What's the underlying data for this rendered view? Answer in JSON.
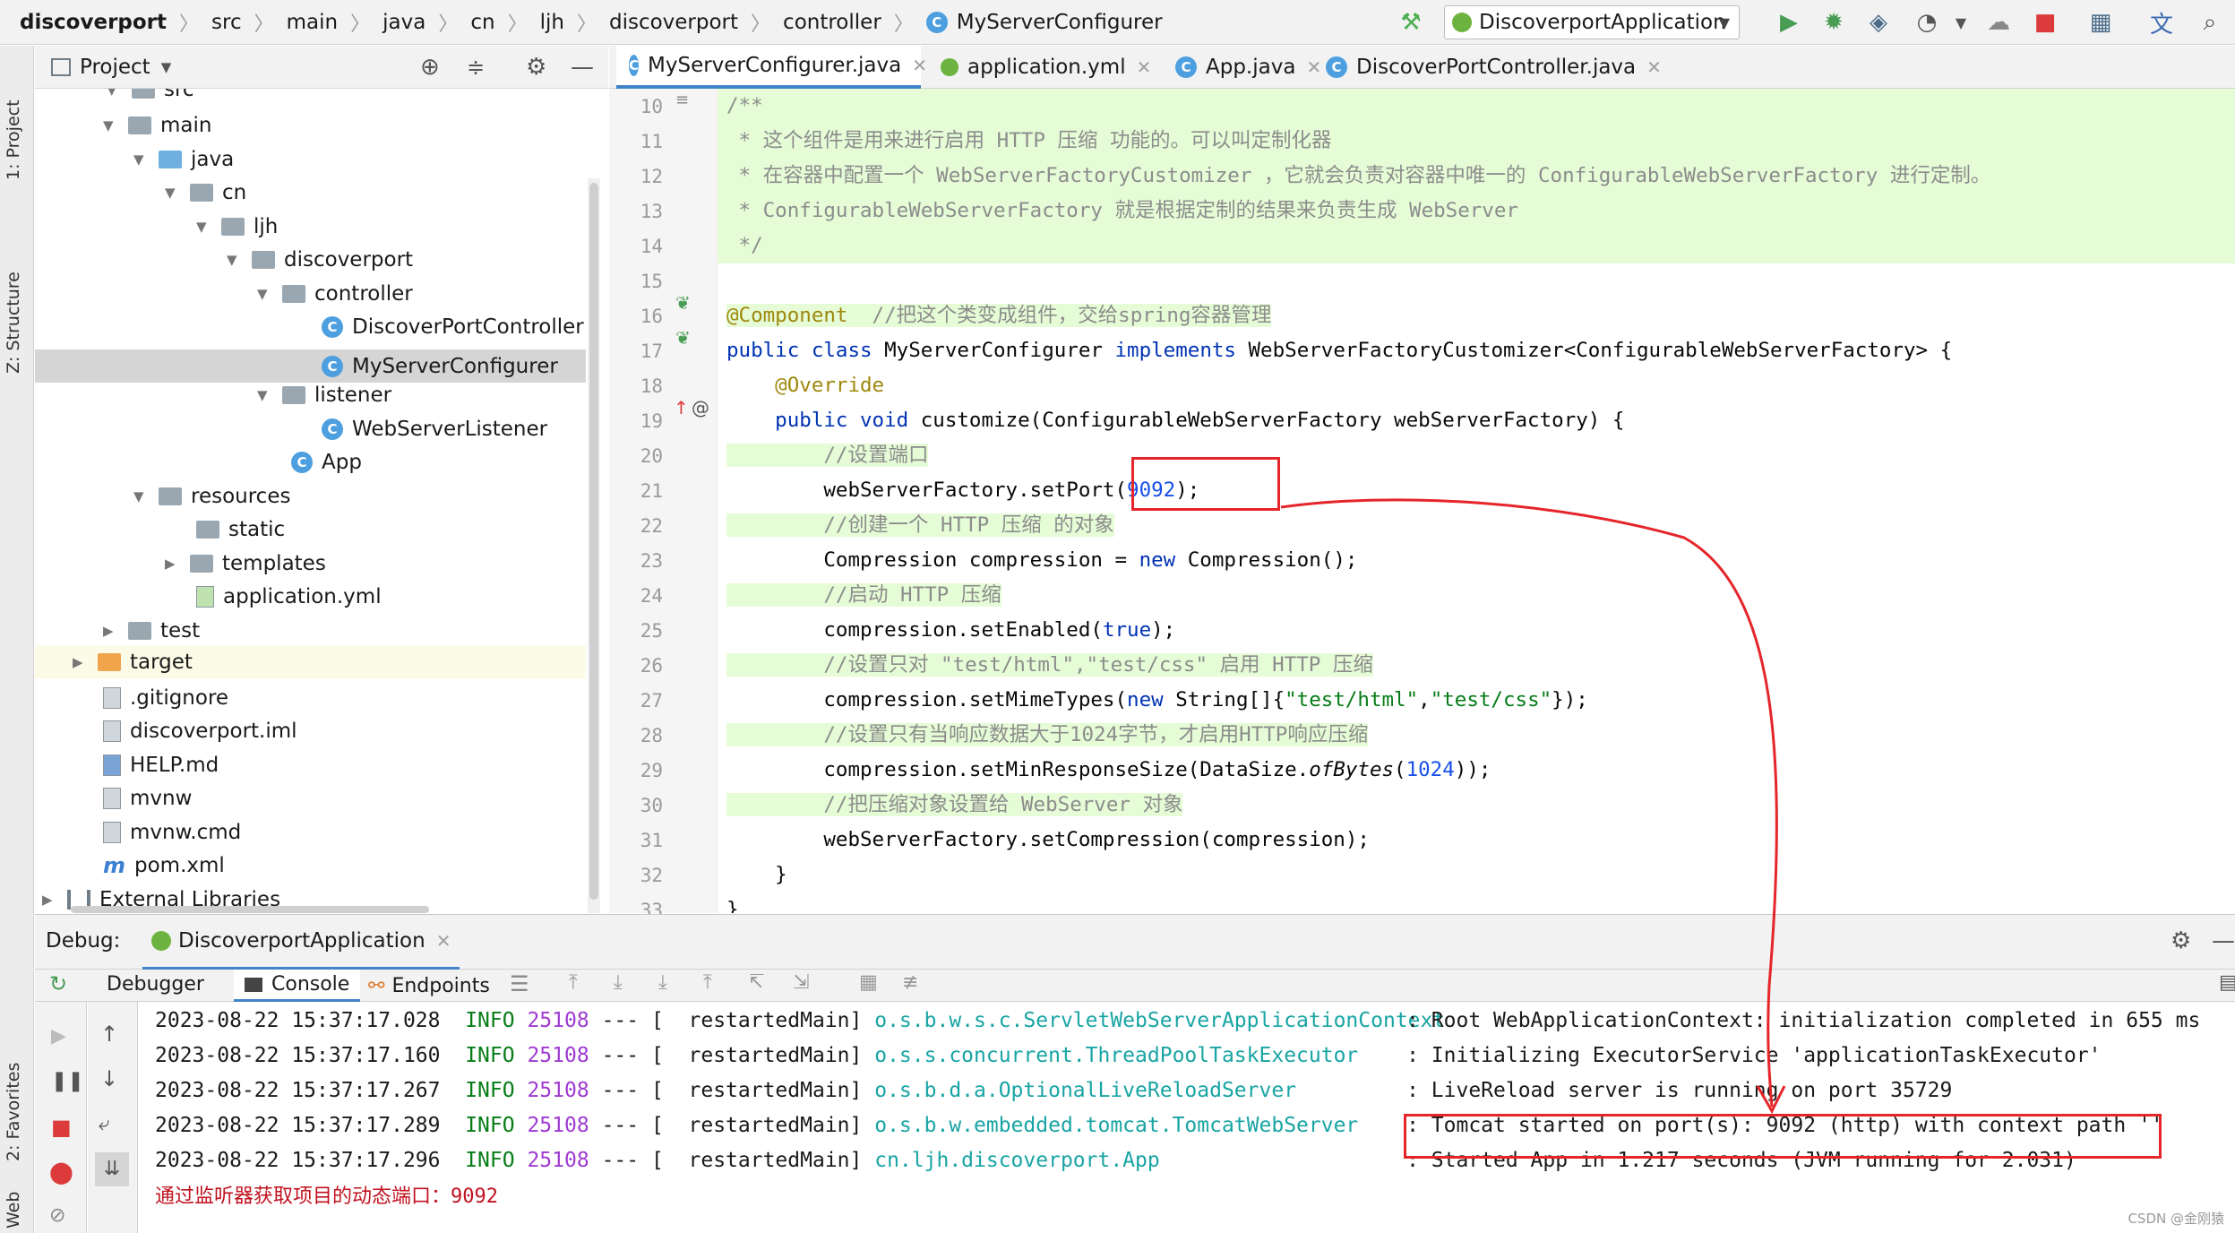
{
  "breadcrumb": [
    "discoverport",
    "src",
    "main",
    "java",
    "cn",
    "ljh",
    "discoverport",
    "controller",
    "MyServerConfigurer"
  ],
  "run_config": "DiscoverportApplication",
  "left_strip": {
    "project": "1: Project",
    "structure": "Z: Structure",
    "favorites": "2: Favorites",
    "web": "Web"
  },
  "project_panel": {
    "title": "Project"
  },
  "tree": [
    {
      "label": "src"
    },
    {
      "label": "main"
    },
    {
      "label": "java"
    },
    {
      "label": "cn"
    },
    {
      "label": "ljh"
    },
    {
      "label": "discoverport"
    },
    {
      "label": "controller"
    },
    {
      "label": "DiscoverPortController"
    },
    {
      "label": "MyServerConfigurer"
    },
    {
      "label": "listener"
    },
    {
      "label": "WebServerListener"
    },
    {
      "label": "App"
    },
    {
      "label": "resources"
    },
    {
      "label": "static"
    },
    {
      "label": "templates"
    },
    {
      "label": "application.yml"
    },
    {
      "label": "test"
    },
    {
      "label": "target"
    },
    {
      "label": ".gitignore"
    },
    {
      "label": "discoverport.iml"
    },
    {
      "label": "HELP.md"
    },
    {
      "label": "mvnw"
    },
    {
      "label": "mvnw.cmd"
    },
    {
      "label": "pom.xml"
    },
    {
      "label": "External Libraries"
    }
  ],
  "editor_tabs": [
    "MyServerConfigurer.java",
    "application.yml",
    "App.java",
    "DiscoverPortController.java"
  ],
  "line_numbers": [
    "10",
    "11",
    "12",
    "13",
    "14",
    "15",
    "16",
    "17",
    "18",
    "19",
    "20",
    "21",
    "22",
    "23",
    "24",
    "25",
    "26",
    "27",
    "28",
    "29",
    "30",
    "31",
    "32",
    "33"
  ],
  "code": {
    "l10": "/**",
    "l11": " * 这个组件是用来进行启用 HTTP 压缩 功能的。可以叫定制化器",
    "l12": " * 在容器中配置一个 WebServerFactoryCustomizer ，它就会负责对容器中唯一的 ConfigurableWebServerFactory 进行定制。",
    "l13": " * ConfigurableWebServerFactory 就是根据定制的结果来负责生成 WebServer",
    "l14": " */",
    "l16_a": "@Component",
    "l16_b": "  //把这个类变成组件，交给spring容器管理",
    "l17_a": "public class",
    "l17_b": " MyServerConfigurer ",
    "l17_c": "implements",
    "l17_d": " WebServerFactoryCustomizer<ConfigurableWebServerFactory> {",
    "l18": "    @Override",
    "l19_a": "    public void",
    "l19_b": " customize(ConfigurableWebServerFactory webServerFactory) {",
    "l20": "        //设置端口",
    "l21_a": "        webServerFactory.setPort(",
    "l21_b": "9092",
    "l21_c": ");",
    "l22": "        //创建一个 HTTP 压缩 的对象",
    "l23_a": "        Compression compression = ",
    "l23_b": "new",
    "l23_c": " Compression();",
    "l24": "        //启动 HTTP 压缩",
    "l25_a": "        compression.setEnabled(",
    "l25_b": "true",
    "l25_c": ");",
    "l26": "        //设置只对 \"test/html\",\"test/css\" 启用 HTTP 压缩",
    "l27_a": "        compression.setMimeTypes(",
    "l27_b": "new",
    "l27_c": " String[]{",
    "l27_d": "\"test/html\"",
    "l27_e": ",",
    "l27_f": "\"test/css\"",
    "l27_g": "});",
    "l28": "        //设置只有当响应数据大于1024字节，才启用HTTP响应压缩",
    "l29_a": "        compression.setMinResponseSize(DataSize.",
    "l29_b": "ofBytes",
    "l29_c": "(",
    "l29_d": "1024",
    "l29_e": "));",
    "l30": "        //把压缩对象设置给 WebServer 对象",
    "l31": "        webServerFactory.setCompression(compression);",
    "l32": "    }",
    "l33": "}"
  },
  "debug": {
    "label": "Debug:",
    "session": "DiscoverportApplication",
    "tabs": [
      "Debugger",
      "Console",
      "Endpoints"
    ]
  },
  "console": [
    {
      "ts": "2023-08-22 15:37:17.028",
      "level": "INFO",
      "pid": "25108",
      "sep": "--- [",
      "thread": "  restartedMain]",
      "logger": "o.s.b.w.s.c.ServletWebServerApplicationContext",
      "msg": " : Root WebApplicationContext: initialization completed in 655 ms"
    },
    {
      "ts": "2023-08-22 15:37:17.160",
      "level": "INFO",
      "pid": "25108",
      "sep": "--- [",
      "thread": "  restartedMain]",
      "logger": "o.s.s.concurrent.ThreadPoolTaskExecutor",
      "msg": " : Initializing ExecutorService 'applicationTaskExecutor'"
    },
    {
      "ts": "2023-08-22 15:37:17.267",
      "level": "INFO",
      "pid": "25108",
      "sep": "--- [",
      "thread": "  restartedMain]",
      "logger": "o.s.b.d.a.OptionalLiveReloadServer",
      "msg": " : LiveReload server is running on port 35729"
    },
    {
      "ts": "2023-08-22 15:37:17.289",
      "level": "INFO",
      "pid": "25108",
      "sep": "--- [",
      "thread": "  restartedMain]",
      "logger": "o.s.b.w.embedded.tomcat.TomcatWebServer",
      "msg": " : Tomcat started on port(s): 9092 (http) with context path ''"
    },
    {
      "ts": "2023-08-22 15:37:17.296",
      "level": "INFO",
      "pid": "25108",
      "sep": "--- [",
      "thread": "  restartedMain]",
      "logger": "cn.ljh.discoverport.App",
      "msg": " : Started App in 1.217 seconds (JVM running for 2.031)"
    }
  ],
  "console_last": "通过监听器获取项目的动态端口：9092",
  "watermark": "CSDN @金刚猿",
  "colors": {
    "annotation": "#e5252a",
    "highlight": "#e5fcd6",
    "keyword": "#0033b3",
    "string": "#067d17"
  }
}
